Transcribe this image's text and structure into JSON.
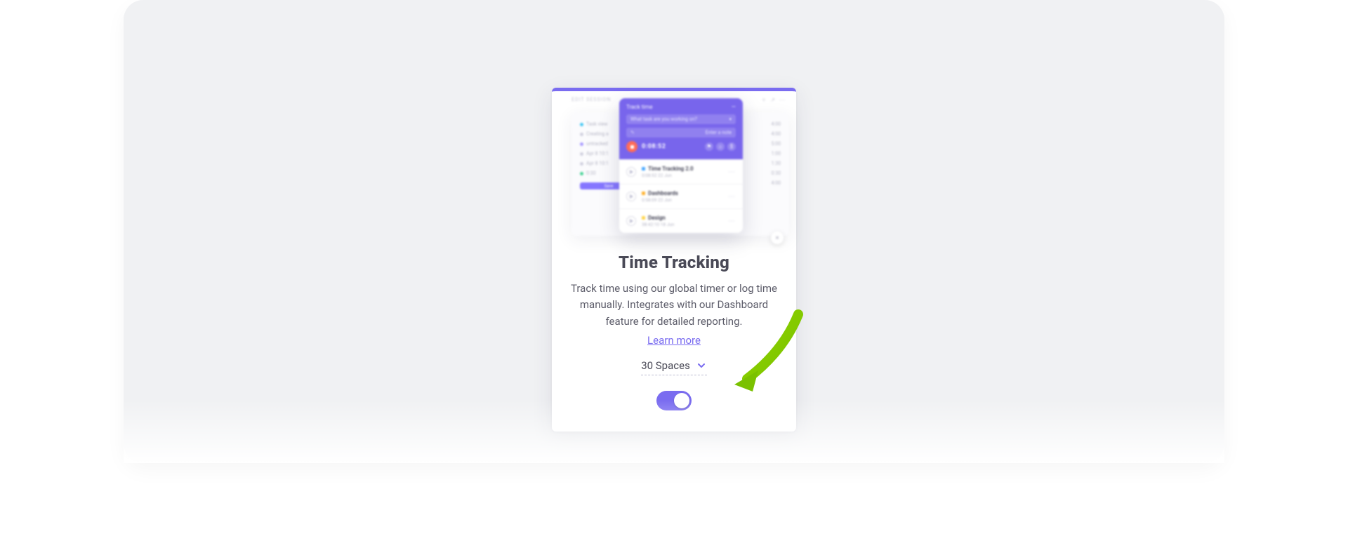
{
  "card": {
    "title": "Time Tracking",
    "description": "Track time using our global timer or log time manually. Integrates with our Dashboard feature for detailed reporting.",
    "learn_more": "Learn more",
    "spaces_label": "30 Spaces",
    "toggle_on": true
  },
  "illustration": {
    "bg_header": "EDIT SESSION",
    "bg_rows": [
      "Task view",
      "Creating a",
      "untracked",
      "Apr 8  10:1",
      "Apr 8  10:1",
      "0:30"
    ],
    "bg_save": "Save",
    "bg_right": [
      "4:00",
      "4:00",
      "5:00",
      "1:00",
      "1:30",
      "0:30",
      "4:00"
    ],
    "widget": {
      "title": "Track time",
      "task_placeholder": "What task are you working on?",
      "note_placeholder": "Enter a note",
      "timer": "0:08:52",
      "tasks": [
        {
          "name": "Time Tracking 2.0",
          "sub": "0:08:52  22 Jun"
        },
        {
          "name": "Dashboards",
          "sub": "0:58:09  22 Jun"
        },
        {
          "name": "Design",
          "sub": "38:42:10  18 Jun"
        }
      ]
    }
  }
}
